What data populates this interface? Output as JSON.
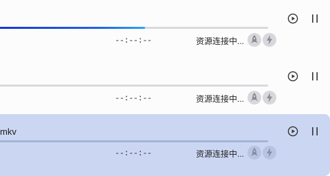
{
  "downloads": [
    {
      "name": "",
      "progress": 0.54,
      "time_remaining": "--:--:--",
      "status": "资源连接中...",
      "selected": false,
      "icons": {
        "accelerate": "rocket-icon",
        "speed": "lightning-icon",
        "play": "play-circle-icon",
        "pause": "pause-icon"
      }
    },
    {
      "name": "",
      "progress": 0,
      "time_remaining": "--:--:--",
      "status": "资源连接中...",
      "selected": false,
      "icons": {
        "accelerate": "rocket-icon",
        "speed": "lightning-icon",
        "play": "play-circle-icon",
        "pause": "pause-icon"
      }
    },
    {
      "name": "mkv",
      "progress": 0,
      "time_remaining": "--:--:--",
      "status": "资源连接中...",
      "selected": true,
      "icons": {
        "accelerate": "rocket-icon",
        "speed": "lightning-icon",
        "play": "play-circle-icon",
        "pause": "pause-icon"
      }
    }
  ],
  "colors": {
    "progress_start": "#1a36d6",
    "progress_end": "#2aa6f0",
    "selected_row": "#cbd7f2",
    "track": "#d9d9de"
  }
}
